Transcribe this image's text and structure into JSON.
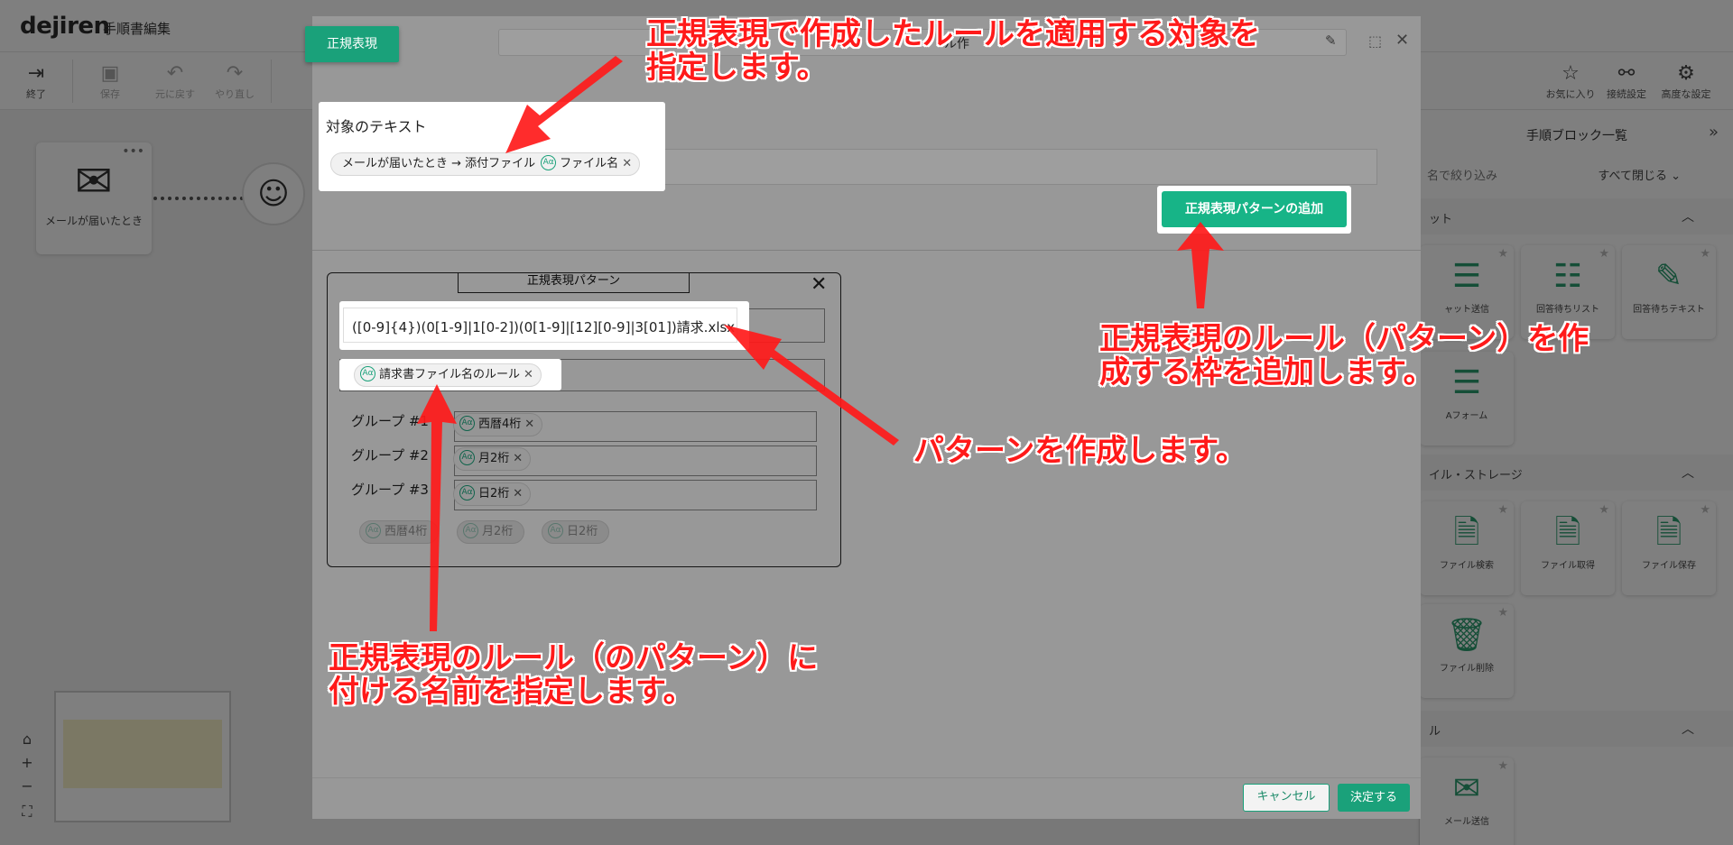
{
  "app": {
    "logo": "dejiren",
    "doc_title": "手順書編集",
    "toolbar": [
      {
        "label": "終了",
        "icon": "exit-icon"
      },
      {
        "label": "保存",
        "icon": "save-icon"
      },
      {
        "label": "元に戻す",
        "icon": "undo-icon"
      },
      {
        "label": "やり直し",
        "icon": "redo-icon"
      }
    ],
    "right_tools": [
      {
        "label": "お気に入り",
        "icon": "star-icon"
      },
      {
        "label": "接続設定",
        "icon": "connection-icon"
      },
      {
        "label": "高度な設定",
        "icon": "advanced-settings-icon"
      }
    ],
    "flow_node_label": "メールが届いたとき"
  },
  "right_panel": {
    "title": "手順ブロック一覧",
    "filter_placeholder": "名で絞り込み",
    "close_all": "すべて閉じる",
    "sections": [
      {
        "label": "ット",
        "blocks": [
          "ャット送信",
          "回答待ちリスト",
          "回答待ちテキスト",
          "Aフォーム"
        ]
      },
      {
        "label": "イル・ストレージ",
        "blocks": [
          "ファイル検索",
          "ファイル取得",
          "ファイル保存",
          "ファイル削除"
        ]
      },
      {
        "label": "ル",
        "blocks": [
          "メール送信"
        ]
      }
    ]
  },
  "modal": {
    "tag": "正規表現",
    "title_partial": "ル作",
    "target_label": "対象のテキスト",
    "target_chip_source": "メールが届いたとき → 添付ファイル",
    "target_chip_field": "ファイル名",
    "add_pattern_button": "正規表現パターンの追加",
    "pattern_box_title": "正規表現パターン",
    "pattern_value": "([0-9]{4})(0[1-9]|1[0-2])(0[1-9]|[12][0-9]|3[01])請求.xlsx",
    "rule_name": "請求書ファイル名のルール",
    "groups": [
      {
        "label": "グループ #1",
        "chip": "西暦4桁"
      },
      {
        "label": "グループ #2",
        "chip": "月2桁"
      },
      {
        "label": "グループ #3",
        "chip": "日2桁"
      }
    ],
    "suggest_chips": [
      "西暦4桁",
      "月2桁",
      "日2桁"
    ],
    "cancel": "キャンセル",
    "ok": "決定する",
    "aa": "Aα",
    "close": "✕"
  },
  "annotations": {
    "target": "正規表現で作成したルールを適用する対象を\n指定します。",
    "add_pattern": "正規表現のルール（パターン）を作\n成する枠を追加します。",
    "pattern": "パターンを作成します。",
    "name": "正規表現のルール（のパターン）に\n付ける名前を指定します。"
  },
  "colors": {
    "accent": "#1aa17a",
    "annotation": "#ff1a1a"
  }
}
